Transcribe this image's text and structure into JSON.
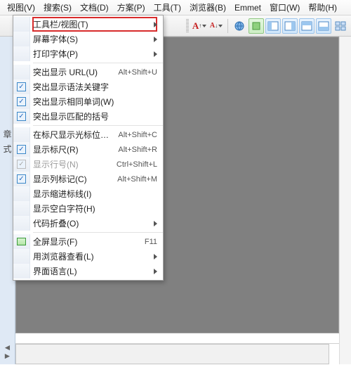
{
  "menubar": {
    "items": [
      {
        "full": "视图(V)",
        "u": "V"
      },
      {
        "full": "搜索(S)",
        "u": "S"
      },
      {
        "full": "文档(D)",
        "u": "D"
      },
      {
        "full": "方案(P)",
        "u": "P"
      },
      {
        "full": "工具(T)",
        "u": "T"
      },
      {
        "full": "浏览器(B)",
        "u": "B"
      },
      {
        "full": "Emmet",
        "u": ""
      },
      {
        "full": "窗口(W)",
        "u": "W"
      },
      {
        "full": "帮助(H)",
        "u": "H"
      }
    ]
  },
  "toolbar": {
    "groups": {
      "left": [
        "toggle-panel",
        "toggle-side",
        "doc-panel"
      ],
      "mid": [
        "font-bigger",
        "font-smaller"
      ],
      "right": [
        "preview-browser",
        "external-tool",
        "window-left",
        "window-right",
        "window-top",
        "window-bottom",
        "tile"
      ]
    }
  },
  "view_menu": {
    "items": [
      {
        "label": "工具栏/视图(T)",
        "submenu": true,
        "highlighted": true
      },
      {
        "label": "屏幕字体(S)",
        "submenu": true
      },
      {
        "label": "打印字体(P)",
        "submenu": true
      },
      {
        "sep": true
      },
      {
        "label": "突出显示 URL(U)",
        "accel": "Alt+Shift+U"
      },
      {
        "label": "突出显示语法关键字",
        "checked": true
      },
      {
        "label": "突出显示相同单词(W)",
        "checked": true
      },
      {
        "label": "突出显示匹配的括号",
        "checked": true
      },
      {
        "sep": true
      },
      {
        "label": "在标尺显示光标位置(I)",
        "accel": "Alt+Shift+C"
      },
      {
        "label": "显示标尺(R)",
        "accel": "Alt+Shift+R",
        "checked": true
      },
      {
        "label": "显示行号(N)",
        "accel": "Ctrl+Shift+L",
        "disabled": true,
        "checked": true,
        "checkgray": true
      },
      {
        "label": "显示列标记(C)",
        "accel": "Alt+Shift+M",
        "checked": true
      },
      {
        "label": "显示缩进标线(I)"
      },
      {
        "label": "显示空白字符(H)"
      },
      {
        "label": "代码折叠(O)",
        "submenu": true
      },
      {
        "sep": true
      },
      {
        "label": "全屏显示(F)",
        "accel": "F11",
        "icon": "fullscreen"
      },
      {
        "label": "用浏览器查看(L)",
        "submenu": true
      },
      {
        "label": "界面语言(L)",
        "submenu": true
      }
    ]
  },
  "gutter": {
    "char1": "章",
    "char2": "式"
  }
}
